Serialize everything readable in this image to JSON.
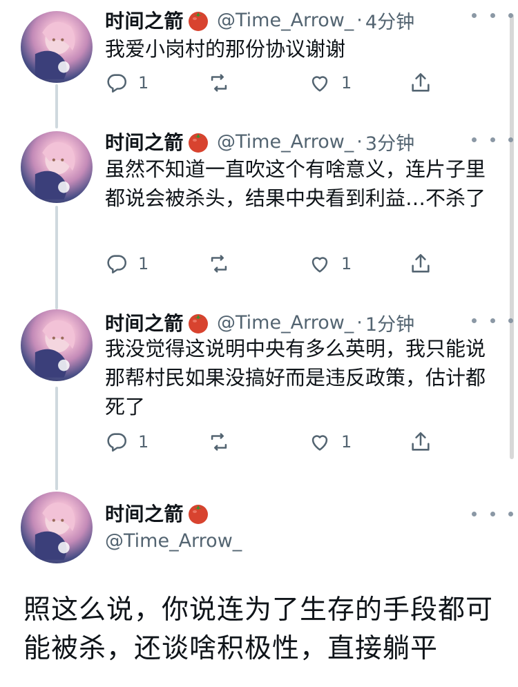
{
  "tweets": [
    {
      "name": "时间之箭",
      "emoji": "tomato",
      "handle": "@Time_Arrow_",
      "separator": "·",
      "time": "4分钟",
      "text": "我爱小岗村的那份协议谢谢",
      "replies": "1",
      "likes": "1"
    },
    {
      "name": "时间之箭",
      "emoji": "tomato",
      "handle": "@Time_Arrow_",
      "separator": "·",
      "time": "3分钟",
      "text": "虽然不知道一直吹这个有啥意义，连片子里都说会被杀头，结果中央看到利益…不杀了",
      "replies": "1",
      "likes": "1"
    },
    {
      "name": "时间之箭",
      "emoji": "tomato",
      "handle": "@Time_Arrow_",
      "separator": "·",
      "time": "1分钟",
      "text": "我没觉得这说明中央有多么英明，我只能说那帮村民如果没搞好而是违反政策，估计都死了",
      "replies": "1",
      "likes": "1"
    }
  ],
  "main_tweet": {
    "name": "时间之箭",
    "emoji": "tomato",
    "handle": "@Time_Arrow_",
    "text": "照这么说，你说连为了生存的手段都可能被杀，还谈啥积极性，直接躺平"
  },
  "colors": {
    "text_primary": "#0f1419",
    "text_secondary": "#536471",
    "thread_line": "#cfd9de"
  },
  "icons": [
    "reply-icon",
    "retweet-icon",
    "like-icon",
    "share-icon",
    "more-icon",
    "tomato-emoji"
  ]
}
